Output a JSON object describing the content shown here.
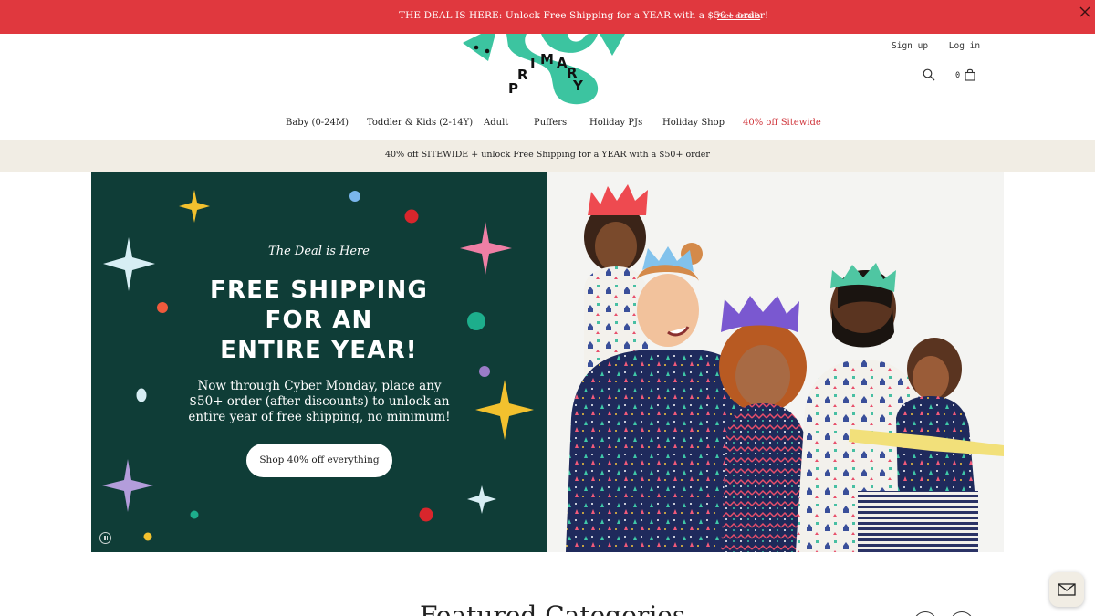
{
  "announcement": {
    "text": "THE DEAL IS HERE: Unlock Free Shipping for a YEAR with a $50+ order!",
    "link": "*see details"
  },
  "header": {
    "logo_text": "PRIMARY",
    "sign_up": "Sign up",
    "log_in": "Log in",
    "cart_count": "0"
  },
  "nav": {
    "items": [
      {
        "label": "Baby (0-24M)"
      },
      {
        "label": "Toddler & Kids (2-14Y)"
      },
      {
        "label": "Adult"
      },
      {
        "label": "Puffers"
      },
      {
        "label": "Holiday PJs"
      },
      {
        "label": "Holiday Shop"
      },
      {
        "label": "40% off Sitewide"
      }
    ]
  },
  "promo_strip": {
    "text": "40% off SITEWIDE + unlock Free Shipping for a YEAR with a $50+ order"
  },
  "hero": {
    "kicker": "The Deal is Here",
    "headline_lines": [
      "FREE SHIPPING",
      "FOR AN",
      "ENTIRE YEAR!"
    ],
    "body": "Now through Cyber Monday, place any $50+ order (after discounts) to unlock an entire year of free shipping, no minimum!",
    "button": "Shop 40% off everything"
  },
  "section": {
    "title": "Featured Categories"
  },
  "colors": {
    "announce_bg": "#e0383e",
    "hero_green": "#0f3d37",
    "logo_teal": "#3cc4a0",
    "sale_red": "#d0363c",
    "strip_cream": "#f1ede4"
  }
}
